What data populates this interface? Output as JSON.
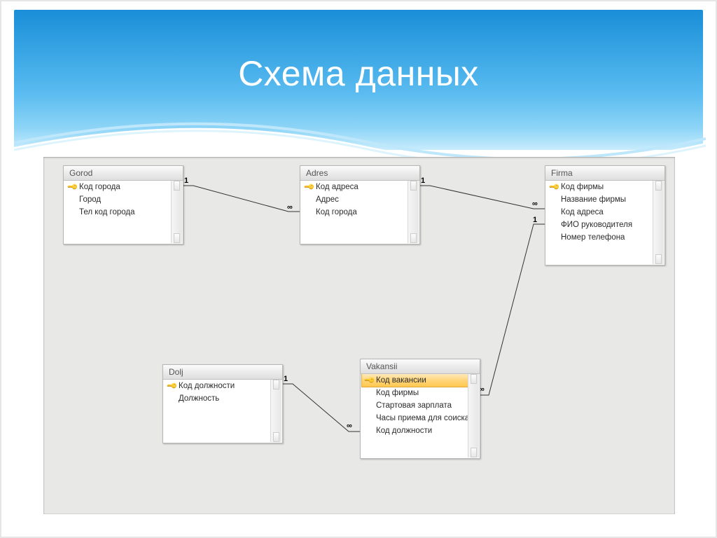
{
  "slide": {
    "title": "Схема данных"
  },
  "tables": {
    "gorod": {
      "title": "Gorod",
      "fields": [
        {
          "label": "Код города",
          "pk": true
        },
        {
          "label": "Город",
          "pk": false
        },
        {
          "label": "Тел код города",
          "pk": false
        }
      ]
    },
    "adres": {
      "title": "Adres",
      "fields": [
        {
          "label": "Код адреса",
          "pk": true
        },
        {
          "label": "Адрес",
          "pk": false
        },
        {
          "label": "Код города",
          "pk": false
        }
      ]
    },
    "firma": {
      "title": "Firma",
      "fields": [
        {
          "label": "Код фирмы",
          "pk": true
        },
        {
          "label": "Название фирмы",
          "pk": false
        },
        {
          "label": "Код адреса",
          "pk": false
        },
        {
          "label": "ФИО руководителя",
          "pk": false
        },
        {
          "label": "Номер телефона",
          "pk": false
        }
      ]
    },
    "dolj": {
      "title": "Dolj",
      "fields": [
        {
          "label": "Код должности",
          "pk": true
        },
        {
          "label": "Должность",
          "pk": false
        }
      ]
    },
    "vakansii": {
      "title": "Vakansii",
      "fields": [
        {
          "label": "Код вакансии",
          "pk": true,
          "selected": true
        },
        {
          "label": "Код фирмы",
          "pk": false
        },
        {
          "label": "Стартовая зарплата",
          "pk": false
        },
        {
          "label": "Часы приема для соискателей",
          "pk": false
        },
        {
          "label": "Код должности",
          "pk": false
        }
      ]
    }
  },
  "relations": {
    "one": "1",
    "many": "∞"
  },
  "chart_data": {
    "type": "table",
    "description": "Entity-relationship diagram (MS Access relationships view)",
    "entities": [
      {
        "name": "Gorod",
        "pk": "Код города",
        "attrs": [
          "Код города",
          "Город",
          "Тел код города"
        ]
      },
      {
        "name": "Adres",
        "pk": "Код адреса",
        "attrs": [
          "Код адреса",
          "Адрес",
          "Код города"
        ]
      },
      {
        "name": "Firma",
        "pk": "Код фирмы",
        "attrs": [
          "Код фирмы",
          "Название фирмы",
          "Код адреса",
          "ФИО руководителя",
          "Номер телефона"
        ]
      },
      {
        "name": "Dolj",
        "pk": "Код должности",
        "attrs": [
          "Код должности",
          "Должность"
        ]
      },
      {
        "name": "Vakansii",
        "pk": "Код вакансии",
        "attrs": [
          "Код вакансии",
          "Код фирмы",
          "Стартовая зарплата",
          "Часы приема для соискателей",
          "Код должности"
        ]
      }
    ],
    "relationships": [
      {
        "from": "Gorod",
        "from_card": "1",
        "to": "Adres",
        "to_card": "∞",
        "on": "Код города"
      },
      {
        "from": "Adres",
        "from_card": "1",
        "to": "Firma",
        "to_card": "∞",
        "on": "Код адреса"
      },
      {
        "from": "Dolj",
        "from_card": "1",
        "to": "Vakansii",
        "to_card": "∞",
        "on": "Код должности"
      },
      {
        "from": "Firma",
        "from_card": "1",
        "to": "Vakansii",
        "to_card": "∞",
        "on": "Код фирмы"
      }
    ]
  }
}
